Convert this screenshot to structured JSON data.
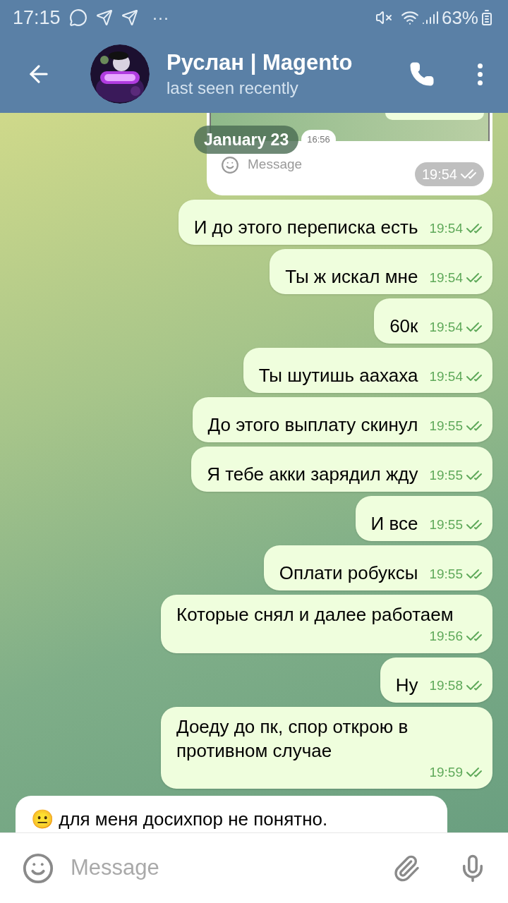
{
  "status_bar": {
    "time": "17:15",
    "more": "···",
    "battery": "63%"
  },
  "header": {
    "title": "Руслан | Magento",
    "subtitle": "last seen recently"
  },
  "date_pill": "January 23",
  "image_message": {
    "inner_time": "16:56",
    "inner_placeholder": "Message",
    "time": "19:54",
    "read": true
  },
  "messages": [
    {
      "kind": "outgoing",
      "text": "И до этого переписка есть",
      "time": "19:54",
      "read": true
    },
    {
      "kind": "outgoing",
      "text": "Ты ж искал мне",
      "time": "19:54",
      "read": true
    },
    {
      "kind": "outgoing",
      "text": "60к",
      "time": "19:54",
      "read": true
    },
    {
      "kind": "outgoing",
      "text": "Ты шутишь аахаха",
      "time": "19:54",
      "read": true
    },
    {
      "kind": "outgoing",
      "text": "До этого выплату скинул",
      "time": "19:55",
      "read": true
    },
    {
      "kind": "outgoing",
      "text": "Я тебе акки зарядил жду",
      "time": "19:55",
      "read": true
    },
    {
      "kind": "outgoing",
      "text": "И все",
      "time": "19:55",
      "read": true
    },
    {
      "kind": "outgoing",
      "text": "Оплати робуксы",
      "time": "19:55",
      "read": true
    },
    {
      "kind": "outgoing",
      "text": "Которые снял и далее работаем",
      "time": "19:56",
      "read": true
    },
    {
      "kind": "outgoing",
      "text": "Ну",
      "time": "19:58",
      "read": true
    },
    {
      "kind": "outgoing",
      "text": "Доеду до пк, спор открою в противном случае",
      "time": "19:59",
      "read": true
    },
    {
      "kind": "incoming",
      "text": "😐 для меня досихпор не понятно."
    }
  ],
  "composer": {
    "placeholder": "Message"
  }
}
